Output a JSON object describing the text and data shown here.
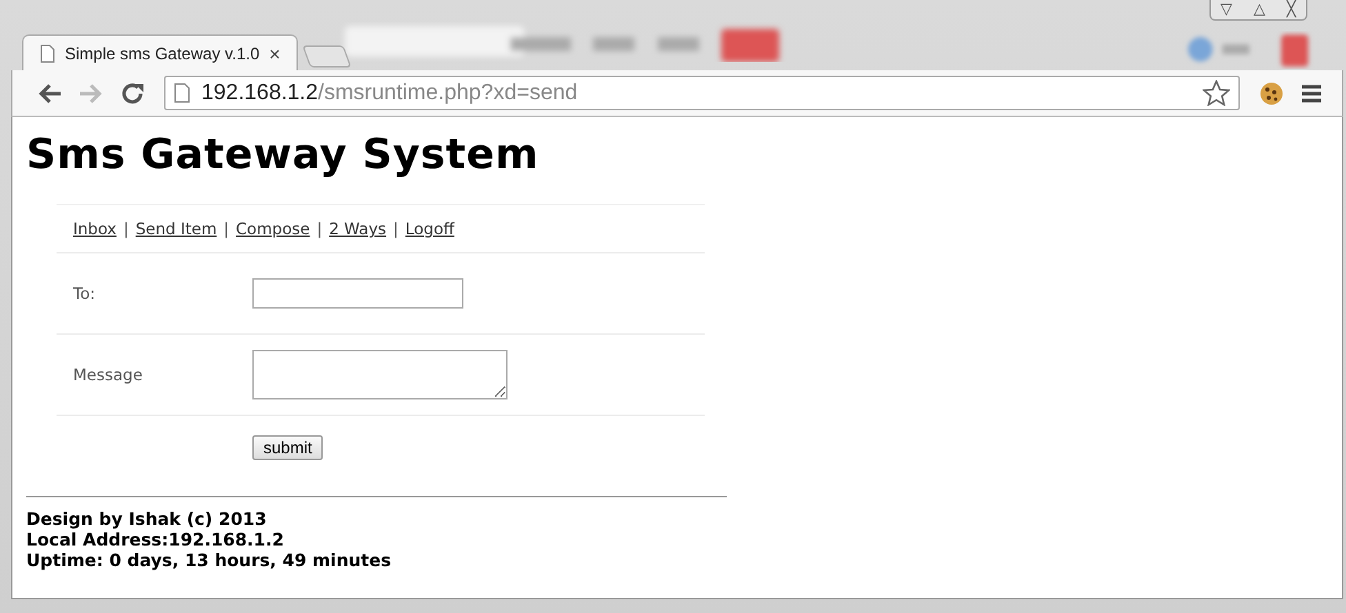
{
  "window": {
    "controls": [
      "▽",
      "△",
      "╳"
    ]
  },
  "tabs": [
    {
      "title": "Simple sms Gateway v.1.0",
      "close": "×",
      "selected": true
    }
  ],
  "address": {
    "host": "192.168.1.2",
    "path": "/smsruntime.php?xd=send"
  },
  "page": {
    "heading": "Sms Gateway System",
    "nav": [
      {
        "label": "Inbox"
      },
      {
        "label": "Send Item"
      },
      {
        "label": "Compose"
      },
      {
        "label": "2 Ways"
      },
      {
        "label": "Logoff"
      }
    ],
    "separator": "|",
    "fields": [
      {
        "label": "To:",
        "kind": "input"
      },
      {
        "label": "Message",
        "kind": "textarea"
      }
    ],
    "submit": "submit",
    "footer": [
      "Design by Ishak (c) 2013",
      "Local Address:192.168.1.2",
      "Uptime: 0 days, 13 hours, 49 minutes"
    ]
  }
}
